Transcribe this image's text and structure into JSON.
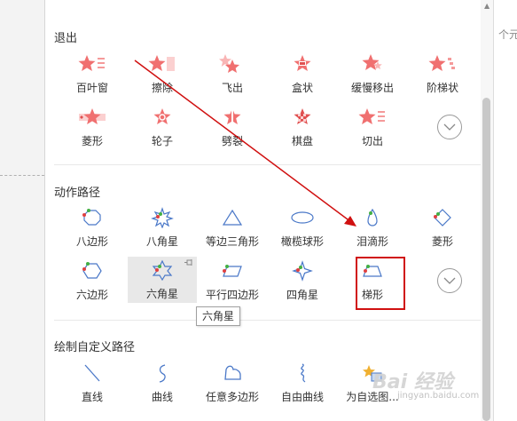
{
  "background_right_text": "个元",
  "sections": {
    "exit": {
      "title": "退出",
      "items": [
        "百叶窗",
        "擦除",
        "飞出",
        "盒状",
        "缓慢移出",
        "阶梯状",
        "菱形",
        "轮子",
        "劈裂",
        "棋盘",
        "切出"
      ]
    },
    "paths": {
      "title": "动作路径",
      "items": [
        "八边形",
        "八角星",
        "等边三角形",
        "橄榄球形",
        "泪滴形",
        "菱形",
        "六边形",
        "六角星",
        "平行四边形",
        "四角星",
        "梯形"
      ]
    },
    "custom": {
      "title": "绘制自定义路径",
      "items": [
        "直线",
        "曲线",
        "任意多边形",
        "自由曲线",
        "为自选图..."
      ]
    }
  },
  "tooltip": "六角星",
  "watermark": "Bai 经验",
  "watermark_sub": "jingyan.baidu.com",
  "colors": {
    "accent_red": "#d01010",
    "star_pink": "#f07070",
    "path_blue": "#4a78c8"
  }
}
